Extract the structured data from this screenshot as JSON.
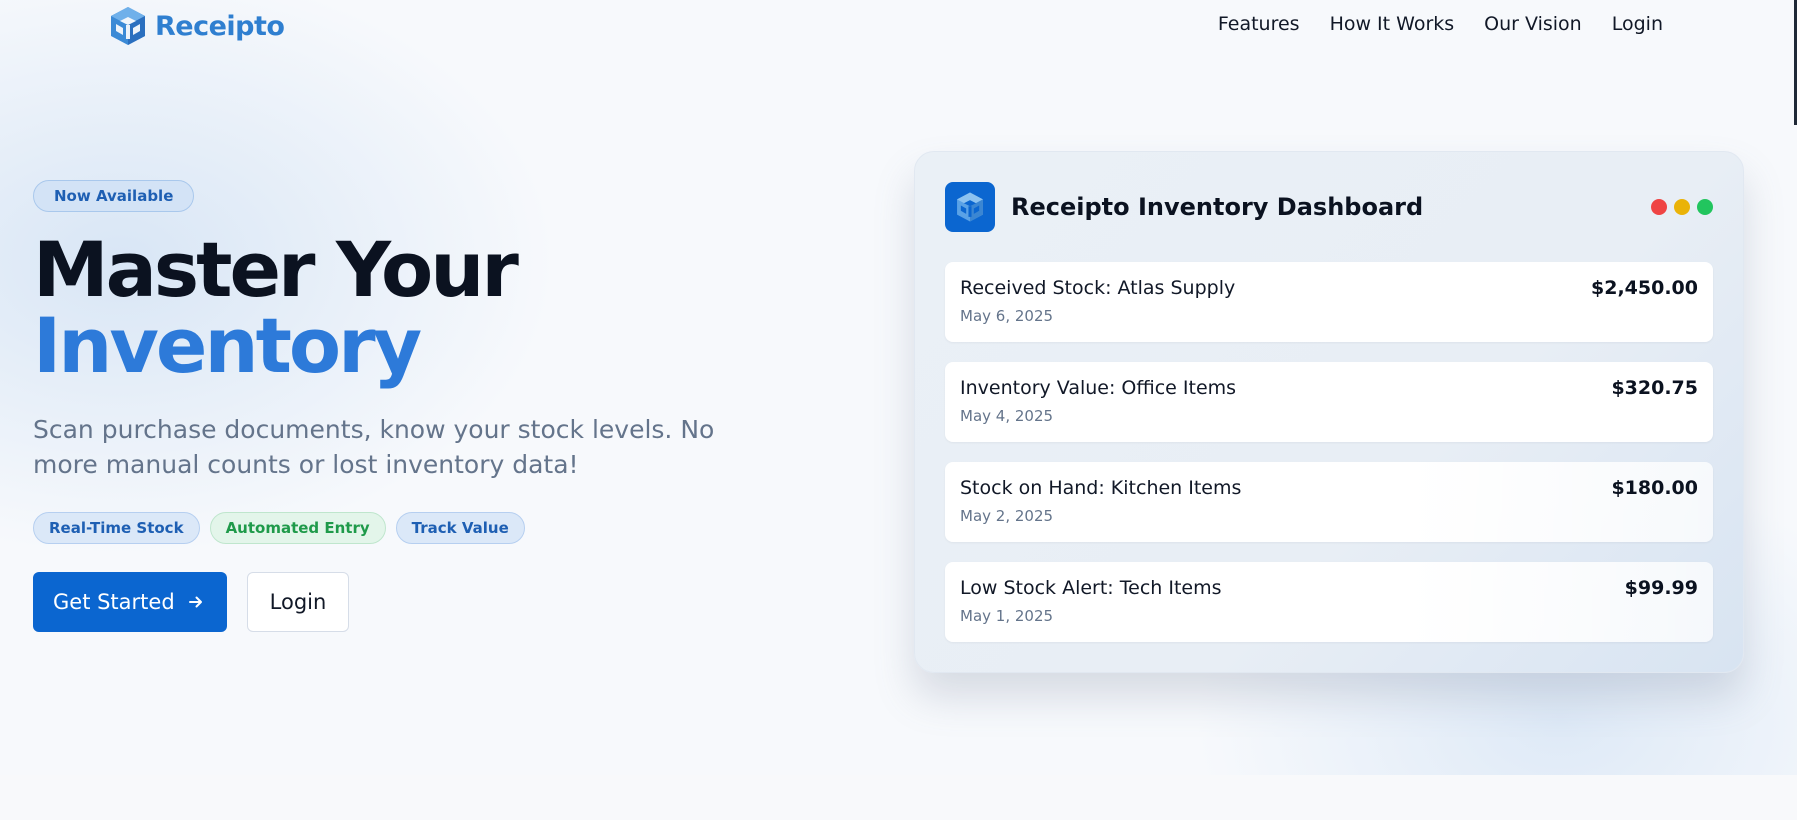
{
  "brand": {
    "name": "Receipto",
    "icon": "cube-logo-icon",
    "color": "#2f7fd0"
  },
  "nav": {
    "items": [
      "Features",
      "How It Works",
      "Our Vision",
      "Login"
    ]
  },
  "hero": {
    "badge": "Now Available",
    "headline_line1": "Master Your",
    "headline_line2": "Inventory",
    "subtitle": "Scan purchase documents, know your stock levels. No more manual counts or lost inventory data!",
    "tags": [
      "Real-Time Stock",
      "Automated Entry",
      "Track Value"
    ],
    "cta_primary": "Get Started",
    "cta_primary_icon": "arrow-right-icon",
    "cta_secondary": "Login"
  },
  "dashboard": {
    "title": "Receipto Inventory Dashboard",
    "window_dots": [
      "#ef4444",
      "#eab308",
      "#22c55e"
    ],
    "rows": [
      {
        "title": "Received Stock: Atlas Supply",
        "date": "May 6, 2025",
        "amount": "$2,450.00"
      },
      {
        "title": "Inventory Value: Office Items",
        "date": "May 4, 2025",
        "amount": "$320.75"
      },
      {
        "title": "Stock on Hand: Kitchen Items",
        "date": "May 2, 2025",
        "amount": "$180.00"
      },
      {
        "title": "Low Stock Alert: Tech Items",
        "date": "May 1, 2025",
        "amount": "$99.99"
      }
    ]
  },
  "colors": {
    "accent": "#0b66d0",
    "headline_accent": "#2d7ad9",
    "muted_text": "#64748b"
  }
}
